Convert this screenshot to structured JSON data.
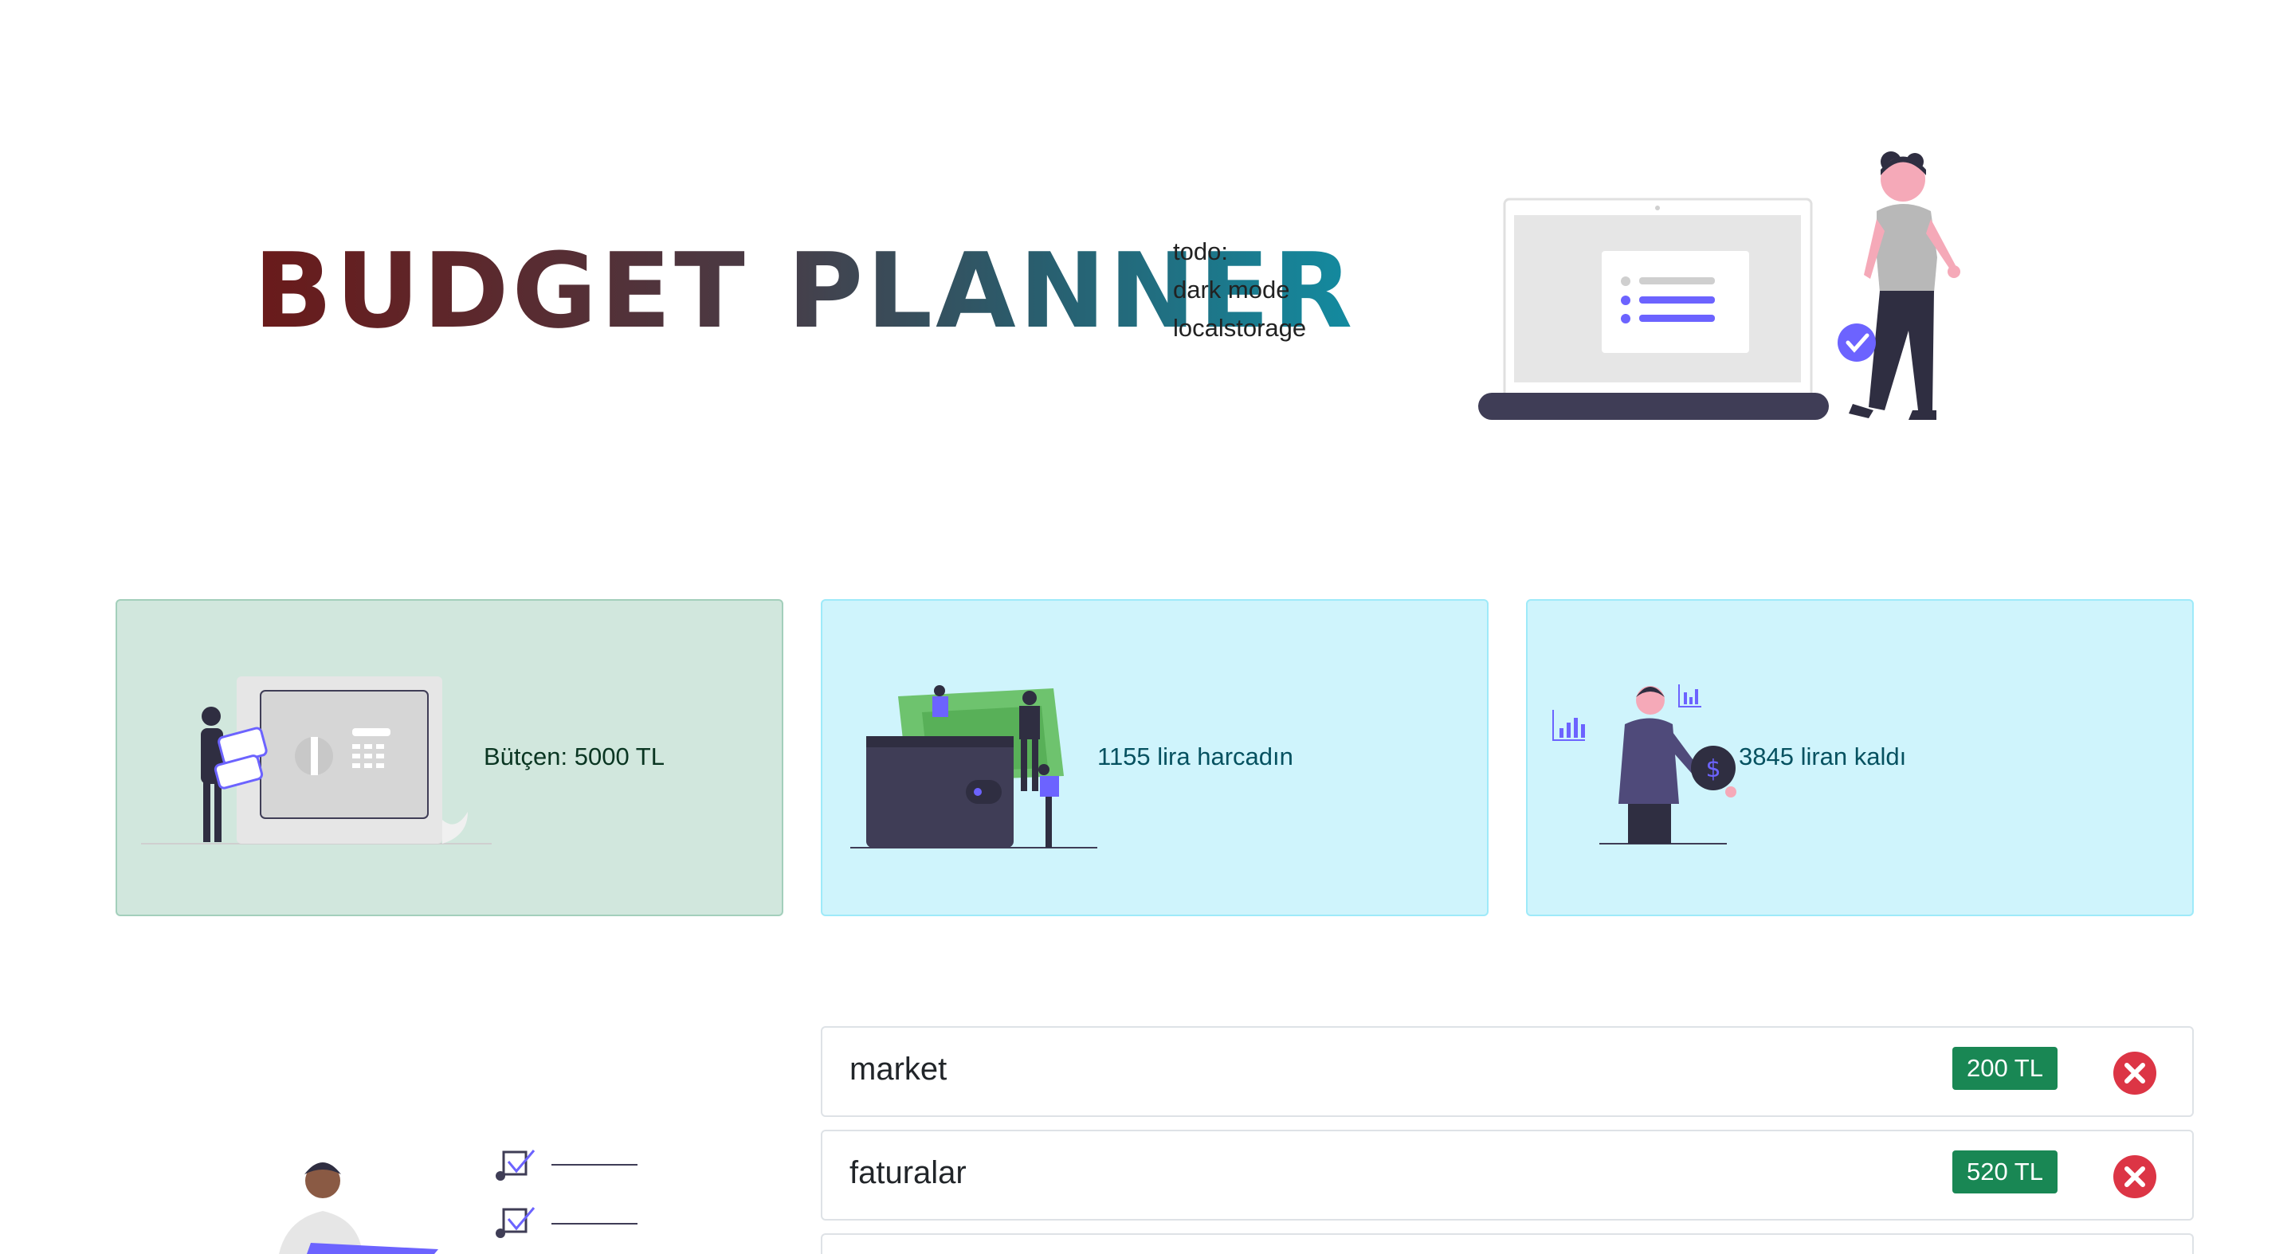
{
  "header": {
    "title": "BUDGET PLANNER",
    "todo": [
      "todo:",
      "dark mode",
      "localstorage"
    ]
  },
  "cards": {
    "budget": "Bütçen: 5000 TL",
    "spent": "1155 lira harcadın",
    "remaining": "3845 liran kaldı"
  },
  "expenses": [
    {
      "name": "market",
      "amount": "200 TL"
    },
    {
      "name": "faturalar",
      "amount": "520 TL"
    }
  ],
  "colors": {
    "success_card_bg": "#d1e7dd",
    "info_card_bg": "#cff4fc",
    "badge": "#198754",
    "delete": "#dc3545",
    "accent": "#6c63ff"
  }
}
